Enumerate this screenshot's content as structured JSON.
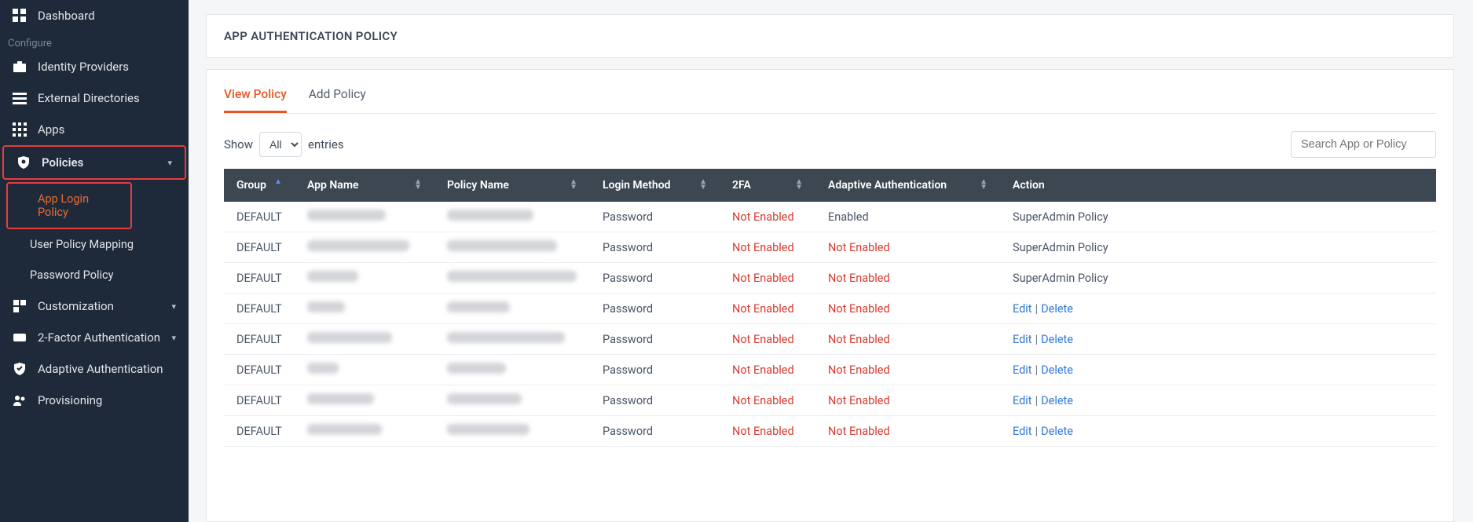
{
  "sidebar": {
    "items": [
      {
        "label": "Dashboard"
      },
      {
        "section": "Configure"
      },
      {
        "label": "Identity Providers"
      },
      {
        "label": "External Directories"
      },
      {
        "label": "Apps"
      },
      {
        "label": "Policies"
      },
      {
        "sub": true,
        "label": "App Login Policy"
      },
      {
        "sub": true,
        "label": "User Policy Mapping"
      },
      {
        "sub": true,
        "label": "Password Policy"
      },
      {
        "label": "Customization"
      },
      {
        "label": "2-Factor Authentication"
      },
      {
        "label": "Adaptive Authentication"
      },
      {
        "label": "Provisioning"
      }
    ]
  },
  "page": {
    "title": "APP AUTHENTICATION POLICY"
  },
  "tabs": {
    "view": "View Policy",
    "add": "Add Policy"
  },
  "entries_control": {
    "show": "Show",
    "options": [
      "All"
    ],
    "selected": "All",
    "entries": "entries"
  },
  "search": {
    "placeholder": "Search App or Policy"
  },
  "table": {
    "headers": {
      "group": "Group",
      "app_name": "App Name",
      "policy_name": "Policy Name",
      "login_method": "Login Method",
      "two_fa": "2FA",
      "adaptive": "Adaptive Authentication",
      "action": "Action"
    },
    "rows": [
      {
        "group": "DEFAULT",
        "app_w": 100,
        "policy_w": 110,
        "login": "Password",
        "twofa": "Not Enabled",
        "adaptive": "Enabled",
        "adaptive_red": false,
        "action_type": "text",
        "action_text": "SuperAdmin Policy"
      },
      {
        "group": "DEFAULT",
        "app_w": 130,
        "policy_w": 140,
        "login": "Password",
        "twofa": "Not Enabled",
        "adaptive": "Not Enabled",
        "adaptive_red": true,
        "action_type": "text",
        "action_text": "SuperAdmin Policy"
      },
      {
        "group": "DEFAULT",
        "app_w": 65,
        "policy_w": 165,
        "login": "Password",
        "twofa": "Not Enabled",
        "adaptive": "Not Enabled",
        "adaptive_red": true,
        "action_type": "text",
        "action_text": "SuperAdmin Policy"
      },
      {
        "group": "DEFAULT",
        "app_w": 48,
        "policy_w": 80,
        "login": "Password",
        "twofa": "Not Enabled",
        "adaptive": "Not Enabled",
        "adaptive_red": true,
        "action_type": "links"
      },
      {
        "group": "DEFAULT",
        "app_w": 108,
        "policy_w": 150,
        "login": "Password",
        "twofa": "Not Enabled",
        "adaptive": "Not Enabled",
        "adaptive_red": true,
        "action_type": "links"
      },
      {
        "group": "DEFAULT",
        "app_w": 40,
        "policy_w": 75,
        "login": "Password",
        "twofa": "Not Enabled",
        "adaptive": "Not Enabled",
        "adaptive_red": true,
        "action_type": "links"
      },
      {
        "group": "DEFAULT",
        "app_w": 85,
        "policy_w": 95,
        "login": "Password",
        "twofa": "Not Enabled",
        "adaptive": "Not Enabled",
        "adaptive_red": true,
        "action_type": "links"
      },
      {
        "group": "DEFAULT",
        "app_w": 95,
        "policy_w": 105,
        "login": "Password",
        "twofa": "Not Enabled",
        "adaptive": "Not Enabled",
        "adaptive_red": true,
        "action_type": "links"
      }
    ],
    "action_links": {
      "edit": "Edit",
      "delete": "Delete"
    }
  }
}
